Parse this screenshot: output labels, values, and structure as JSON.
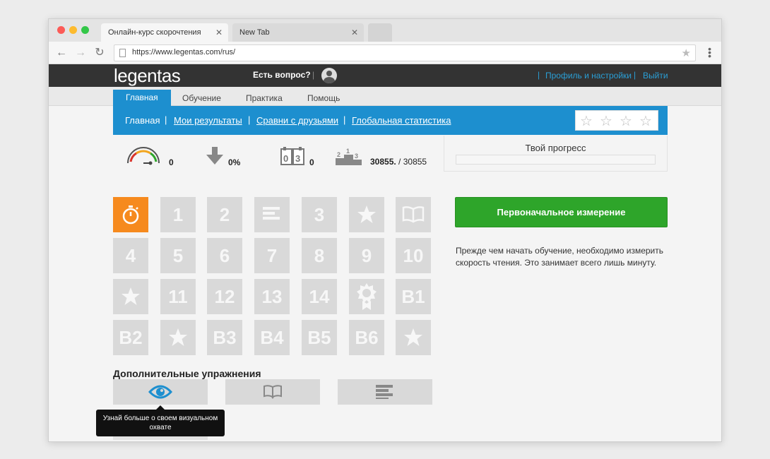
{
  "browser": {
    "tabs": [
      {
        "title": "Онлайн-курс скорочтения",
        "active": true
      },
      {
        "title": "New Tab",
        "active": false
      }
    ],
    "url": "https://www.legentas.com/rus/"
  },
  "header": {
    "logo": "legentas",
    "question": "Есть вопрос?",
    "profile": "Профиль и настройки",
    "logout": "Выйти"
  },
  "main_tabs": [
    "Главная",
    "Обучение",
    "Практика",
    "Помощь"
  ],
  "sub_nav": [
    "Главная",
    "Мои результаты",
    "Сравни с друзьями",
    "Глобальная статистика"
  ],
  "stats": {
    "speed": "0",
    "change": "0%",
    "counter": "0",
    "rank": "30855.",
    "rank_total": "/ 30855"
  },
  "progress": {
    "title": "Твой прогресс",
    "value": 0
  },
  "lessons": [
    [
      "timer",
      "1",
      "2",
      "text",
      "3",
      "star",
      "book"
    ],
    [
      "4",
      "5",
      "6",
      "7",
      "8",
      "9",
      "10"
    ],
    [
      "star",
      "11",
      "12",
      "13",
      "14",
      "badge",
      "B1"
    ],
    [
      "B2",
      "star",
      "B3",
      "B4",
      "B5",
      "B6",
      "star"
    ]
  ],
  "start_button": "Первоначальное измерение",
  "description": "Прежде чем начать обучение, необходимо измерить скорость чтения. Это занимает всего лишь минуту.",
  "extra": {
    "title": "Дополнительные упражнения",
    "tooltip": "Узнай больше о своем визуальном охвате"
  },
  "colors": {
    "accent": "#1d8fcf",
    "green": "#2ea52a",
    "orange": "#f68a1e",
    "tile": "#d9d9d9"
  }
}
